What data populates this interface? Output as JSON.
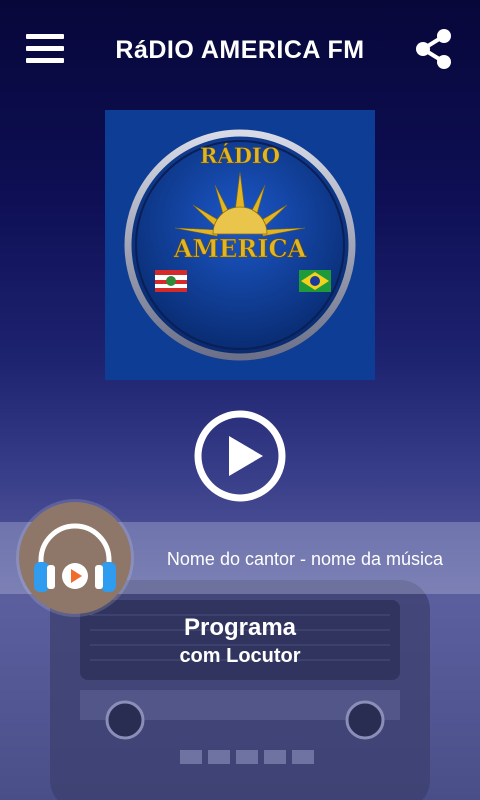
{
  "header": {
    "title": "RáDIO AMERICA FM",
    "menu_icon": "hamburger-menu-icon",
    "share_icon": "share-icon"
  },
  "logo": {
    "top_text": "RÁDIO",
    "main_text": "AMERICA",
    "flags": [
      "santa-catarina-flag",
      "brazil-flag"
    ]
  },
  "player": {
    "play_icon": "play-icon",
    "now_playing": "Nome do cantor - nome da música",
    "avatar_icon": "headphones-play-icon"
  },
  "program": {
    "name": "Programa",
    "host": "com Locutor"
  },
  "colors": {
    "background_top": "#07073a",
    "background_bottom": "#5b5f9e",
    "logo_blue": "#0c3b8f",
    "logo_gold": "#e2b622",
    "avatar_brown": "#8e7668",
    "headphone_blue": "#2f9cf0",
    "play_orange": "#f26b2a"
  }
}
